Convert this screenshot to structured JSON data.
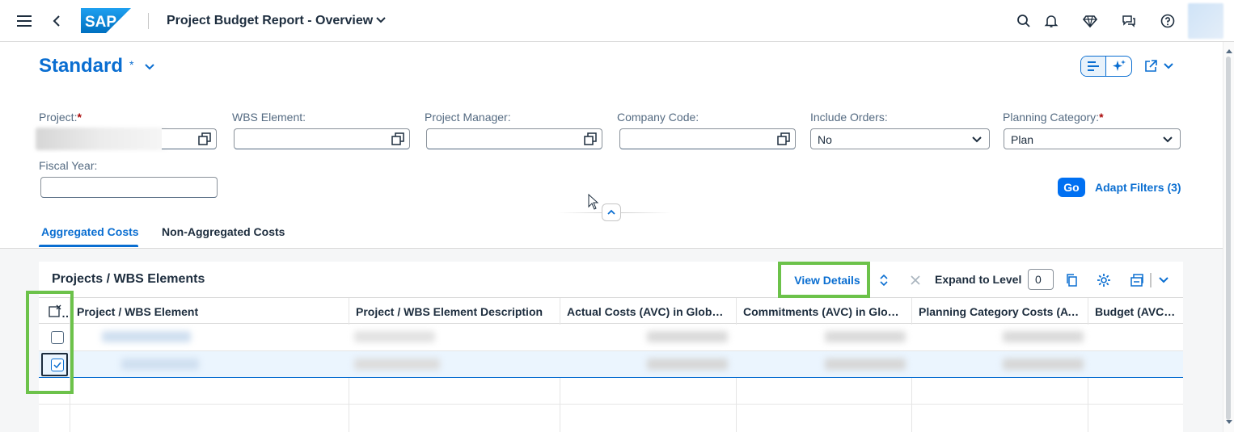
{
  "shell": {
    "logo_text": "SAP",
    "app_title": "Project Budget Report - Overview",
    "icons": [
      "menu-icon",
      "back-icon",
      "search-icon",
      "bell-icon",
      "diamond-icon",
      "chat-icon",
      "help-icon"
    ]
  },
  "header": {
    "variant_name": "Standard",
    "variant_modified": "*"
  },
  "filters": {
    "project_label": "Project:",
    "wbs_label": "WBS Element:",
    "pm_label": "Project Manager:",
    "cc_label": "Company Code:",
    "orders_label": "Include Orders:",
    "orders_value": "No",
    "planning_label": "Planning Category:",
    "planning_value": "Plan",
    "fiscal_label": "Fiscal Year:",
    "required_mark": "*",
    "go": "Go",
    "adapt": "Adapt Filters (3)"
  },
  "tabs": [
    {
      "label": "Aggregated Costs",
      "active": true
    },
    {
      "label": "Non-Aggregated Costs",
      "active": false
    }
  ],
  "table": {
    "title": "Projects / WBS Elements",
    "view_details": "View Details",
    "expand_label": "Expand to Level",
    "expand_value": "0",
    "columns": [
      "Project / WBS Element",
      "Project / WBS Element Description",
      "Actual Costs (AVC) in Global ...",
      "Commitments (AVC) in Global...",
      "Planning Category Costs (AVC...",
      "Budget (AVC) in G"
    ]
  },
  "colors": {
    "accent": "#0a6ed1",
    "highlight": "#6cc24a",
    "go": "#0070f2"
  }
}
